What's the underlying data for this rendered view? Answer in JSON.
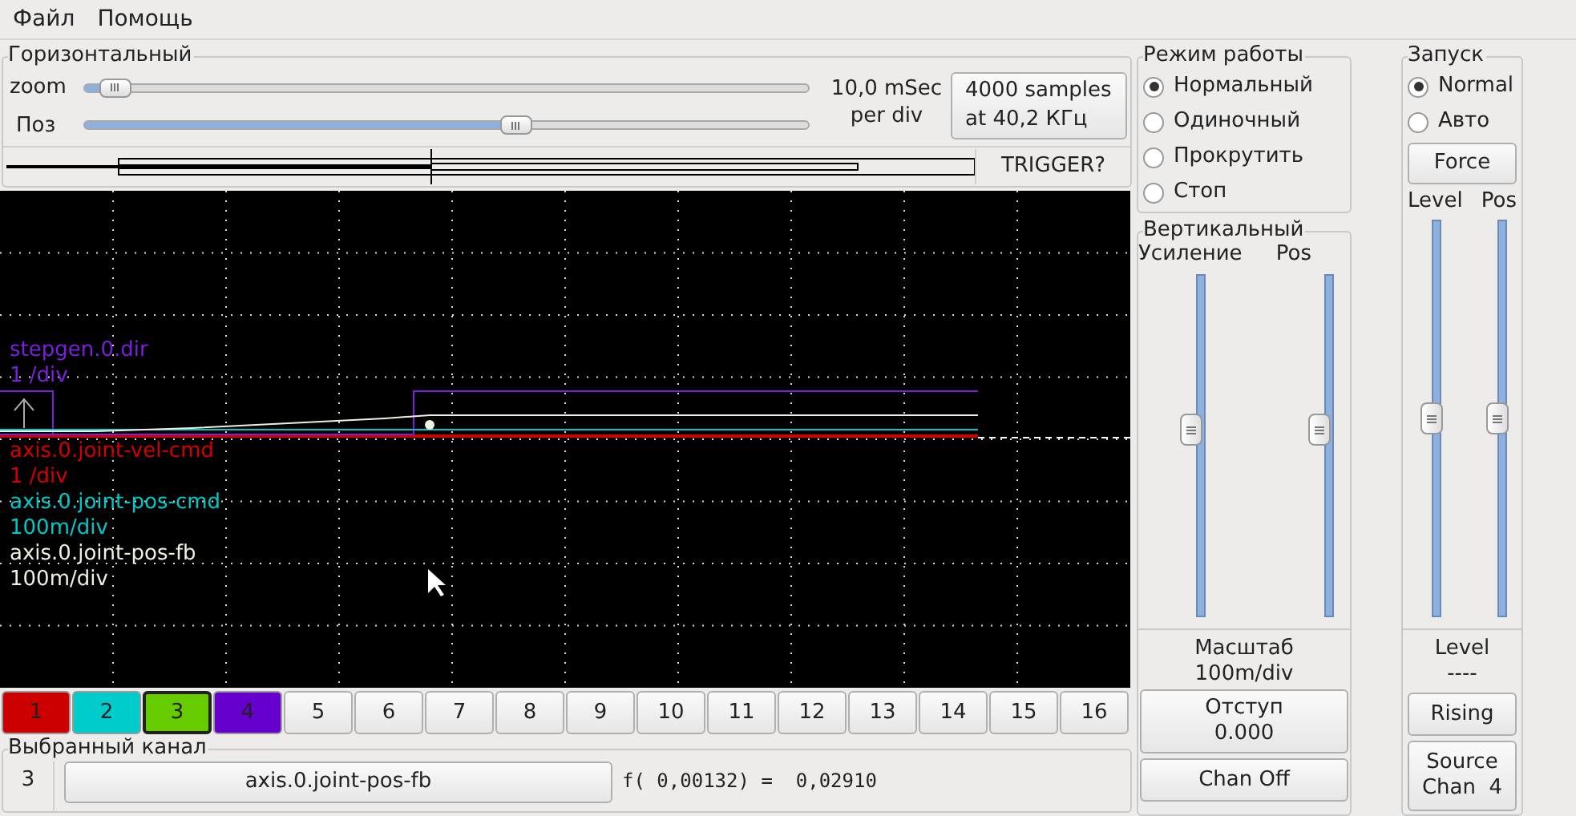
{
  "menu": [
    "Файл",
    "Помощь"
  ],
  "horizontal": {
    "title": "Горизонтальный",
    "sliders": [
      {
        "label": "zoom",
        "level": 0.02
      },
      {
        "label": "Поз",
        "level": 0.6
      }
    ],
    "rate": [
      "10,0 mSec",
      "per div"
    ],
    "samples_button": [
      "4000 samples",
      "at 40,2 КГц"
    ],
    "trigger": "TRIGGER?"
  },
  "traces": [
    {
      "name": "stepgen.0.dir",
      "scale": "1 /div",
      "color": "#7a1fdc"
    },
    {
      "name": "axis.0.joint-vel-cmd",
      "scale": "1 /div",
      "color": "#d40000"
    },
    {
      "name": "axis.0.joint-pos-cmd",
      "scale": "100m/div",
      "color": "#00c8c8"
    },
    {
      "name": "axis.0.joint-pos-fb",
      "scale": "100m/div",
      "color": "#f0f0e0"
    }
  ],
  "channels": [
    {
      "label": "1",
      "color": "#cc0000",
      "selected": false
    },
    {
      "label": "2",
      "color": "#00cccc",
      "selected": false
    },
    {
      "label": "3",
      "color": "#66cc00",
      "selected": true
    },
    {
      "label": "4",
      "color": "#6600cc",
      "selected": false
    },
    {
      "label": "5"
    },
    {
      "label": "6"
    },
    {
      "label": "7"
    },
    {
      "label": "8"
    },
    {
      "label": "9"
    },
    {
      "label": "10"
    },
    {
      "label": "11"
    },
    {
      "label": "12"
    },
    {
      "label": "13"
    },
    {
      "label": "14"
    },
    {
      "label": "15"
    },
    {
      "label": "16"
    }
  ],
  "selected_channel": {
    "title": "Выбранный канал",
    "number": "3",
    "name": "axis.0.joint-pos-fb",
    "readout": "f( 0,00132) =  0,02910"
  },
  "mode": {
    "title": "Режим работы",
    "options": [
      {
        "label": "Нормальный",
        "selected": true
      },
      {
        "label": "Одиночный",
        "selected": false
      },
      {
        "label": "Прокрутить",
        "selected": false
      },
      {
        "label": "Стоп",
        "selected": false
      }
    ]
  },
  "vertical": {
    "title": "Вертикальный",
    "sliders": [
      {
        "label": "Усиление",
        "level": 0.55
      },
      {
        "label": "Pos",
        "level": 0.55
      }
    ],
    "scale": [
      "Масштаб",
      "100m/div"
    ],
    "offset_button": [
      "Отступ",
      "0.000"
    ],
    "chan_off": "Chan Off"
  },
  "trigger": {
    "title": "Запуск",
    "options": [
      {
        "label": "Normal",
        "selected": true
      },
      {
        "label": "Авто",
        "selected": false
      }
    ],
    "force": "Force",
    "sliders": [
      {
        "label": "Level",
        "level": 0.5
      },
      {
        "label": "Pos",
        "level": 0.5
      }
    ],
    "level_caption": "Level",
    "level_value": "----",
    "edge": "Rising",
    "source": [
      "Source",
      "Chan  4"
    ]
  }
}
